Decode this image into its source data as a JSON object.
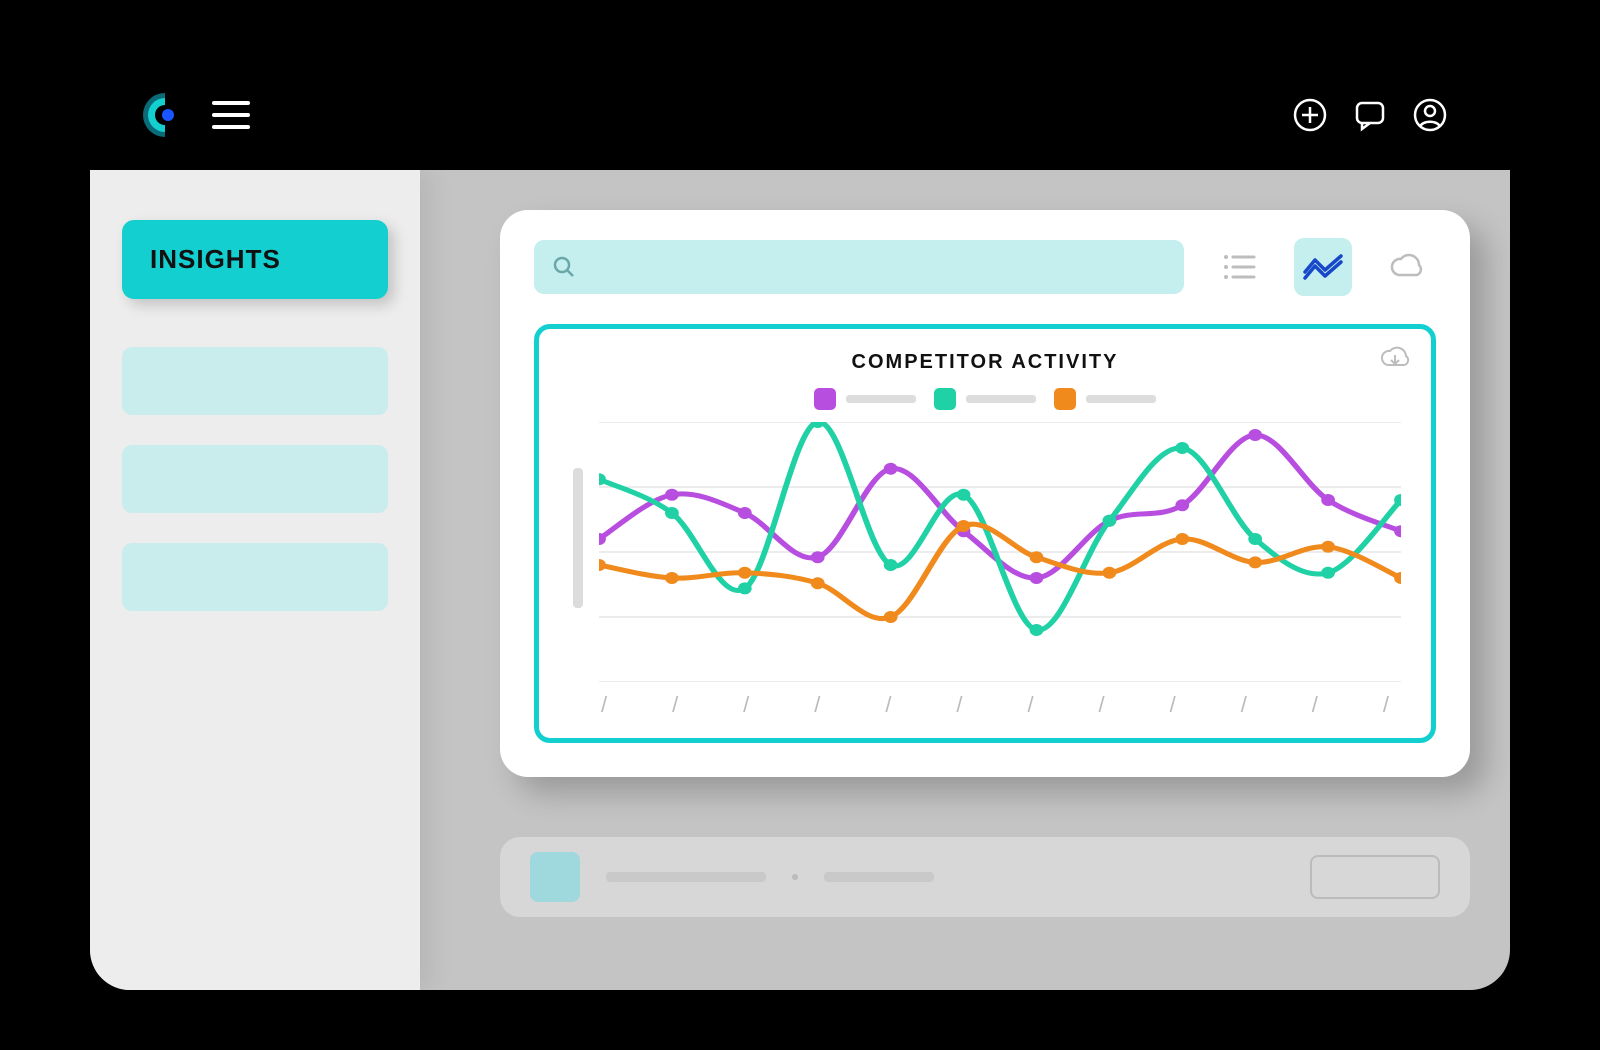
{
  "header": {
    "icons": {
      "logo": "logo",
      "menu": "menu",
      "add": "add",
      "chat": "chat",
      "profile": "profile"
    }
  },
  "sidebar": {
    "insights_label": "INSIGHTS",
    "items": [
      "",
      "",
      ""
    ]
  },
  "search": {
    "placeholder": ""
  },
  "view_toggles": {
    "list": "list-view",
    "chart": "chart-view",
    "cloud": "cloud-view",
    "active": "chart-view"
  },
  "chart": {
    "title": "COMPETITOR ACTIVITY",
    "download_icon": "download"
  },
  "chart_data": {
    "type": "line",
    "x": [
      0,
      1,
      2,
      3,
      4,
      5,
      6,
      7,
      8,
      9,
      10,
      11
    ],
    "ylim": [
      0,
      100
    ],
    "grid": true,
    "series": [
      {
        "name": "",
        "color": "#b84ee0",
        "values": [
          55,
          72,
          65,
          48,
          82,
          58,
          40,
          62,
          68,
          95,
          70,
          58
        ]
      },
      {
        "name": "",
        "color": "#1fd1a5",
        "values": [
          78,
          65,
          36,
          100,
          45,
          72,
          20,
          62,
          90,
          55,
          42,
          70
        ]
      },
      {
        "name": "",
        "color": "#f08a1d",
        "values": [
          45,
          40,
          42,
          38,
          25,
          60,
          48,
          42,
          55,
          46,
          52,
          40
        ]
      }
    ],
    "xticks": [
      "/",
      "/",
      "/",
      "/",
      "/",
      "/",
      "/",
      "/",
      "/",
      "/",
      "/",
      "/"
    ]
  },
  "colors": {
    "accent": "#14cfcf",
    "accent_light": "#c5eeee",
    "bg_sidebar": "#ededed",
    "bg_main": "#c4c4c4"
  }
}
